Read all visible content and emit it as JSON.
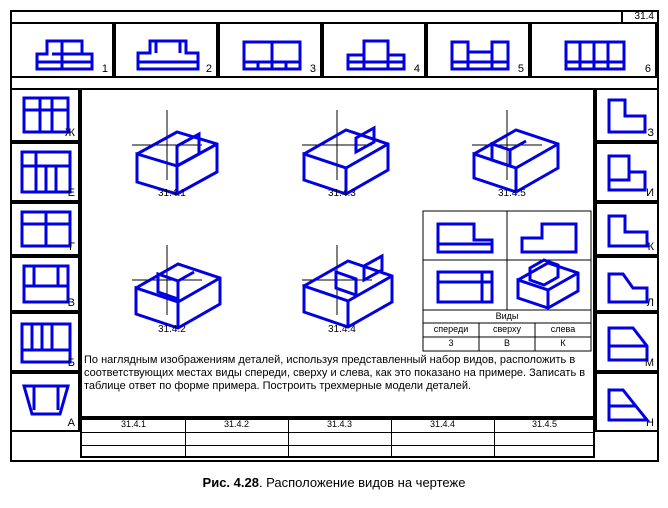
{
  "figure_ref": "31.4",
  "caption_label": "Рис. 4.28",
  "caption_text": ". Расположение видов на чертеже",
  "top_row_numbers": [
    "1",
    "2",
    "3",
    "4",
    "5",
    "6"
  ],
  "left_col_letters": [
    "Ж",
    "Е",
    "Г",
    "В",
    "Б",
    "А"
  ],
  "right_col_letters": [
    "З",
    "И",
    "К",
    "Л",
    "М",
    "Н"
  ],
  "iso_labels": [
    "31.4.1",
    "31.4.3",
    "31.4.5",
    "31.4.2",
    "31.4.4"
  ],
  "views_header": "Виды",
  "views_cols": [
    "спереди",
    "сверху",
    "слева"
  ],
  "views_example": [
    "3",
    "В",
    "К"
  ],
  "bottom_cols": [
    "31.4.1",
    "31.4.2",
    "31.4.3",
    "31.4.4",
    "31.4.5"
  ],
  "instructions": "По наглядным изображениям деталей, используя представленный набор видов, расположить в соответствующих местах виды спереди, сверху и слева, как это показано на примере. Записать в таблице ответ по форме примера. Построить трехмерные модели деталей."
}
